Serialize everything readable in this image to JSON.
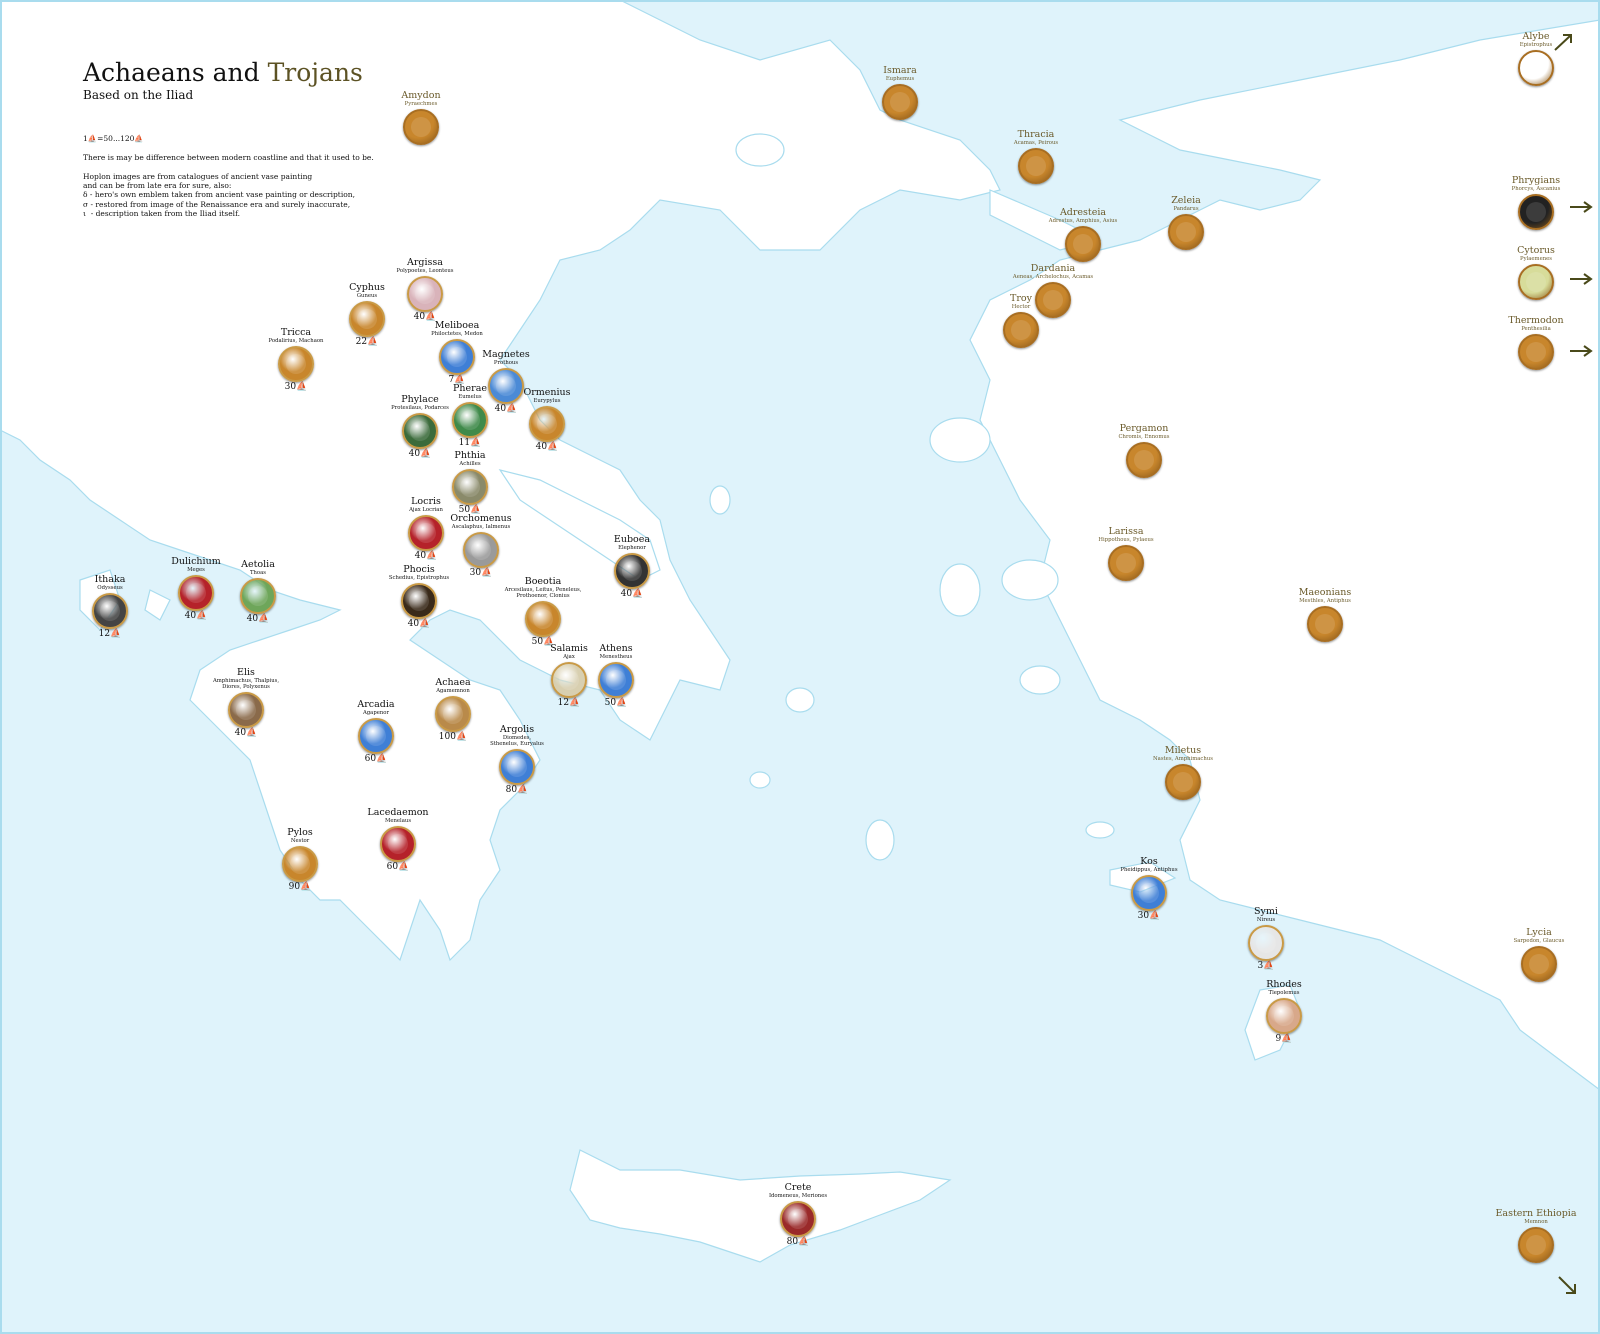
{
  "title": {
    "main": "Achaeans and",
    "highlight": "Trojans"
  },
  "subtitle": "Based on the Iliad",
  "notes": [
    "1⛵=50...120⛵",
    "",
    "There is may be difference between modern coastline and that it used to be.",
    "",
    "Hoplon images are from catalogues of ancient vase painting",
    "and can be from late era for sure, also:",
    "δ - hero's own emblem taken from ancient vase painting or description,",
    "σ - restored from image of the Renaissance era and surely inaccurate,",
    "ι  - description taken from the Iliad itself."
  ],
  "colors": {
    "sea": "#dff3fb",
    "land": "#ffffff",
    "coast": "#a9dcee",
    "trojan": "#6a5a2a",
    "arrow": "#4a4a1a"
  },
  "achaeans": [
    {
      "name": "Argissa",
      "heroes": "Polypoetes, Leonteus",
      "ships": "40⛵",
      "color": "#d9b3ba"
    },
    {
      "name": "Cyphus",
      "heroes": "Guneus",
      "ships": "22⛵",
      "color": "#c8862c"
    },
    {
      "name": "Meliboea",
      "heroes": "Philoctetes, Medon",
      "ships": "7⛵",
      "color": "#3f7fd6"
    },
    {
      "name": "Tricca",
      "heroes": "Podalirius, Machaon",
      "ships": "30⛵",
      "color": "#c8862c"
    },
    {
      "name": "Magnetes",
      "heroes": "Prothous",
      "ships": "40⛵",
      "color": "#4b8ad6"
    },
    {
      "name": "Ormenius",
      "heroes": "Eurypylus",
      "ships": "40⛵",
      "color": "#c8862c"
    },
    {
      "name": "Pherae",
      "heroes": "Eumelus",
      "ships": "11⛵",
      "color": "#3f8a4a"
    },
    {
      "name": "Phylace",
      "heroes": "Protesilaus, Podarces",
      "ships": "40⛵",
      "color": "#3b6b3b"
    },
    {
      "name": "Phthia",
      "heroes": "Achilles",
      "ships": "50⛵",
      "color": "#8a8a6a"
    },
    {
      "name": "Locris",
      "heroes": "Ajax Locrian",
      "ships": "40⛵",
      "color": "#b5222a"
    },
    {
      "name": "Orchomenus",
      "heroes": "Ascalaphus, Ialmenus",
      "ships": "30⛵",
      "color": "#9a9a9a"
    },
    {
      "name": "Euboea",
      "heroes": "Elephenor",
      "ships": "40⛵",
      "color": "#333333"
    },
    {
      "name": "Dulichium",
      "heroes": "Meges",
      "ships": "40⛵",
      "color": "#b5222a"
    },
    {
      "name": "Aetolia",
      "heroes": "Thoas",
      "ships": "40⛵",
      "color": "#6ea65a"
    },
    {
      "name": "Ithaka",
      "heroes": "Odysseus",
      "ships": "12⛵",
      "color": "#444444"
    },
    {
      "name": "Phocis",
      "heroes": "Schedius, Epistrophus",
      "ships": "40⛵",
      "color": "#3a2a1a"
    },
    {
      "name": "Boeotia",
      "heroes": "Arcesilaus, Leitus, Peneleus,\nProthoenor, Clonius",
      "ships": "50⛵",
      "color": "#c8862c"
    },
    {
      "name": "Salamis",
      "heroes": "Ajax",
      "ships": "12⛵",
      "color": "#d8cfb0"
    },
    {
      "name": "Athens",
      "heroes": "Menestheus",
      "ships": "50⛵",
      "color": "#3f7fd6"
    },
    {
      "name": "Elis",
      "heroes": "Amphimachus, Thalpius,\nDiores, Polyxenus",
      "ships": "40⛵",
      "color": "#8a6a4a"
    },
    {
      "name": "Achaea",
      "heroes": "Agamemnon",
      "ships": "100⛵",
      "color": "#b98a4a"
    },
    {
      "name": "Arcadia",
      "heroes": "Agapenor",
      "ships": "60⛵",
      "color": "#3f7fd6"
    },
    {
      "name": "Argolis",
      "heroes": "Diomedes,\nSthenelus, Euryalus",
      "ships": "80⛵",
      "color": "#3f7fd6"
    },
    {
      "name": "Lacedaemon",
      "heroes": "Menelaus",
      "ships": "60⛵",
      "color": "#b5222a"
    },
    {
      "name": "Pylos",
      "heroes": "Nestor",
      "ships": "90⛵",
      "color": "#c8862c"
    },
    {
      "name": "Kos",
      "heroes": "Pheidippus, Antiphus",
      "ships": "30⛵",
      "color": "#3f7fd6"
    },
    {
      "name": "Symi",
      "heroes": "Nireus",
      "ships": "3⛵",
      "color": "#e6e6e6"
    },
    {
      "name": "Rhodes",
      "heroes": "Tlepolemus",
      "ships": "9⛵",
      "color": "#d8a88a"
    },
    {
      "name": "Crete",
      "heroes": "Idomeneus, Meriones",
      "ships": "80⛵",
      "color": "#9a2a2a"
    }
  ],
  "trojans": [
    {
      "name": "Amydon",
      "heroes": "Pyraechmes",
      "color": "#c8862c"
    },
    {
      "name": "Ismara",
      "heroes": "Euphemus",
      "color": "#c8862c"
    },
    {
      "name": "Thracia",
      "heroes": "Acamas, Peirous",
      "color": "#c8862c"
    },
    {
      "name": "Adresteia",
      "heroes": "Adrestus, Amphius, Asius",
      "color": "#c8862c"
    },
    {
      "name": "Zeleia",
      "heroes": "Pandarus",
      "color": "#c8862c"
    },
    {
      "name": "Dardania",
      "heroes": "Aeneas, Archelochus, Acamas",
      "color": "#c8862c"
    },
    {
      "name": "Troy",
      "heroes": "Hector",
      "color": "#c8862c"
    },
    {
      "name": "Alybe",
      "heroes": "Epistrophus",
      "color": "#ffffff"
    },
    {
      "name": "Phrygians",
      "heroes": "Phorcys, Ascanius",
      "color": "#222222"
    },
    {
      "name": "Cytorus",
      "heroes": "Pylaemenes",
      "color": "#d7dc9a"
    },
    {
      "name": "Thermodon",
      "heroes": "Penthesilia",
      "color": "#c8862c"
    },
    {
      "name": "Pergamon",
      "heroes": "Chromis, Ennomus",
      "color": "#c8862c"
    },
    {
      "name": "Larissa",
      "heroes": "Hippothous, Pylaeus",
      "color": "#c8862c"
    },
    {
      "name": "Maeonians",
      "heroes": "Mesthles, Antiphus",
      "color": "#c8862c"
    },
    {
      "name": "Miletus",
      "heroes": "Nastes, Amphimachus",
      "color": "#c8862c"
    },
    {
      "name": "Lycia",
      "heroes": "Sarpedon, Glaucus",
      "color": "#c8862c"
    },
    {
      "name": "Eastern Ethiopia",
      "heroes": "Memnon",
      "color": "#c8862c"
    }
  ]
}
